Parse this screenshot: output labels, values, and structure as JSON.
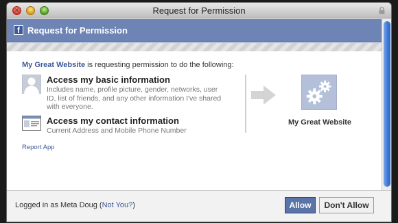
{
  "window": {
    "title": "Request for Permission"
  },
  "header": {
    "logo_letter": "f",
    "title": "Request for Permission"
  },
  "intro": {
    "site_name": "My Great Website",
    "text": "is requesting permission to do the following:"
  },
  "permissions": [
    {
      "title": "Access my basic information",
      "description": "Includes name, profile picture, gender, networks, user ID, list of friends, and any other information I've shared with everyone.",
      "icon": "profile-silhouette-icon"
    },
    {
      "title": "Access my contact information",
      "description": "Current Address and Mobile Phone Number",
      "icon": "contact-card-icon"
    }
  ],
  "app": {
    "name": "My Great Website",
    "icon": "gears-icon"
  },
  "report_link": "Report App",
  "footer": {
    "logged_prefix": "Logged in as Meta Doug (",
    "not_you": "Not You?",
    "logged_suffix": ")",
    "allow_label": "Allow",
    "deny_label": "Don't Allow"
  },
  "colors": {
    "facebook_blue": "#3b5998",
    "header_bar": "#6d84b4",
    "app_tile": "#b4bfda"
  }
}
